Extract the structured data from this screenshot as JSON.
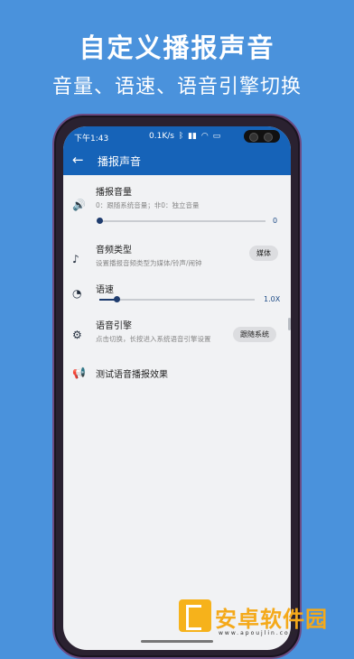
{
  "promo": {
    "headline": "自定义播报声音",
    "subheadline": "音量、语速、语音引擎切换"
  },
  "status_bar": {
    "time": "下午1:43",
    "speed": "0.1K/s",
    "icons": [
      "notification-icon",
      "bluetooth-icon",
      "alarm-icon",
      "signal-icon",
      "wifi-icon",
      "battery-icon"
    ]
  },
  "app_bar": {
    "back_icon": "←",
    "title": "播报声音"
  },
  "settings": {
    "volume": {
      "title": "播报音量",
      "desc": "0：跟随系统音量；非0：独立音量",
      "value": "0",
      "level": 0
    },
    "audio_type": {
      "title": "音频类型",
      "desc": "设置播报音频类型为媒体/铃声/闹钟",
      "chip": "媒体"
    },
    "speed": {
      "title": "语速",
      "value": "1.0X",
      "level": 0.1
    },
    "engine": {
      "title": "语音引擎",
      "desc": "点击切换，长按进入系统语音引擎设置",
      "chip": "跟随系统"
    },
    "test": {
      "title": "测试语音播报效果"
    }
  },
  "watermark": {
    "text": "安卓软件园",
    "url": "www.apoujlin.com"
  }
}
